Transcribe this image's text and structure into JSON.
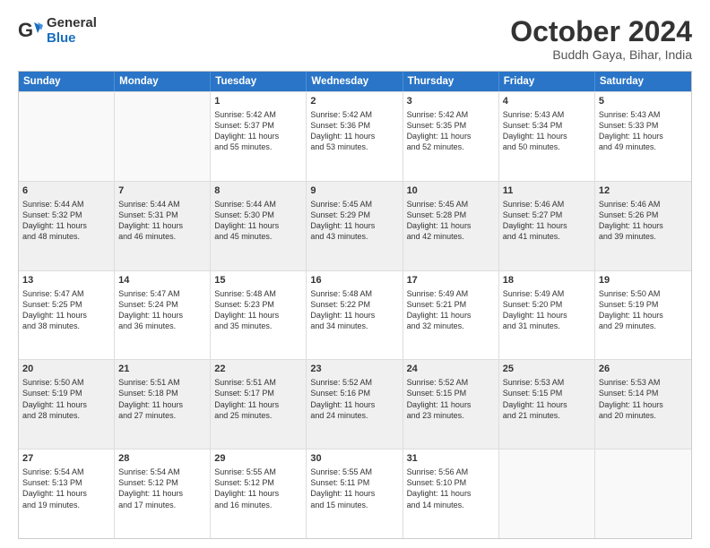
{
  "logo": {
    "general": "General",
    "blue": "Blue"
  },
  "title": {
    "main": "October 2024",
    "sub": "Buddh Gaya, Bihar, India"
  },
  "header_days": [
    "Sunday",
    "Monday",
    "Tuesday",
    "Wednesday",
    "Thursday",
    "Friday",
    "Saturday"
  ],
  "weeks": [
    [
      {
        "day": "",
        "detail": "",
        "empty": true
      },
      {
        "day": "",
        "detail": "",
        "empty": true
      },
      {
        "day": "1",
        "detail": "Sunrise: 5:42 AM\nSunset: 5:37 PM\nDaylight: 11 hours\nand 55 minutes."
      },
      {
        "day": "2",
        "detail": "Sunrise: 5:42 AM\nSunset: 5:36 PM\nDaylight: 11 hours\nand 53 minutes."
      },
      {
        "day": "3",
        "detail": "Sunrise: 5:42 AM\nSunset: 5:35 PM\nDaylight: 11 hours\nand 52 minutes."
      },
      {
        "day": "4",
        "detail": "Sunrise: 5:43 AM\nSunset: 5:34 PM\nDaylight: 11 hours\nand 50 minutes."
      },
      {
        "day": "5",
        "detail": "Sunrise: 5:43 AM\nSunset: 5:33 PM\nDaylight: 11 hours\nand 49 minutes."
      }
    ],
    [
      {
        "day": "6",
        "detail": "Sunrise: 5:44 AM\nSunset: 5:32 PM\nDaylight: 11 hours\nand 48 minutes.",
        "shaded": true
      },
      {
        "day": "7",
        "detail": "Sunrise: 5:44 AM\nSunset: 5:31 PM\nDaylight: 11 hours\nand 46 minutes.",
        "shaded": true
      },
      {
        "day": "8",
        "detail": "Sunrise: 5:44 AM\nSunset: 5:30 PM\nDaylight: 11 hours\nand 45 minutes.",
        "shaded": true
      },
      {
        "day": "9",
        "detail": "Sunrise: 5:45 AM\nSunset: 5:29 PM\nDaylight: 11 hours\nand 43 minutes.",
        "shaded": true
      },
      {
        "day": "10",
        "detail": "Sunrise: 5:45 AM\nSunset: 5:28 PM\nDaylight: 11 hours\nand 42 minutes.",
        "shaded": true
      },
      {
        "day": "11",
        "detail": "Sunrise: 5:46 AM\nSunset: 5:27 PM\nDaylight: 11 hours\nand 41 minutes.",
        "shaded": true
      },
      {
        "day": "12",
        "detail": "Sunrise: 5:46 AM\nSunset: 5:26 PM\nDaylight: 11 hours\nand 39 minutes.",
        "shaded": true
      }
    ],
    [
      {
        "day": "13",
        "detail": "Sunrise: 5:47 AM\nSunset: 5:25 PM\nDaylight: 11 hours\nand 38 minutes."
      },
      {
        "day": "14",
        "detail": "Sunrise: 5:47 AM\nSunset: 5:24 PM\nDaylight: 11 hours\nand 36 minutes."
      },
      {
        "day": "15",
        "detail": "Sunrise: 5:48 AM\nSunset: 5:23 PM\nDaylight: 11 hours\nand 35 minutes."
      },
      {
        "day": "16",
        "detail": "Sunrise: 5:48 AM\nSunset: 5:22 PM\nDaylight: 11 hours\nand 34 minutes."
      },
      {
        "day": "17",
        "detail": "Sunrise: 5:49 AM\nSunset: 5:21 PM\nDaylight: 11 hours\nand 32 minutes."
      },
      {
        "day": "18",
        "detail": "Sunrise: 5:49 AM\nSunset: 5:20 PM\nDaylight: 11 hours\nand 31 minutes."
      },
      {
        "day": "19",
        "detail": "Sunrise: 5:50 AM\nSunset: 5:19 PM\nDaylight: 11 hours\nand 29 minutes."
      }
    ],
    [
      {
        "day": "20",
        "detail": "Sunrise: 5:50 AM\nSunset: 5:19 PM\nDaylight: 11 hours\nand 28 minutes.",
        "shaded": true
      },
      {
        "day": "21",
        "detail": "Sunrise: 5:51 AM\nSunset: 5:18 PM\nDaylight: 11 hours\nand 27 minutes.",
        "shaded": true
      },
      {
        "day": "22",
        "detail": "Sunrise: 5:51 AM\nSunset: 5:17 PM\nDaylight: 11 hours\nand 25 minutes.",
        "shaded": true
      },
      {
        "day": "23",
        "detail": "Sunrise: 5:52 AM\nSunset: 5:16 PM\nDaylight: 11 hours\nand 24 minutes.",
        "shaded": true
      },
      {
        "day": "24",
        "detail": "Sunrise: 5:52 AM\nSunset: 5:15 PM\nDaylight: 11 hours\nand 23 minutes.",
        "shaded": true
      },
      {
        "day": "25",
        "detail": "Sunrise: 5:53 AM\nSunset: 5:15 PM\nDaylight: 11 hours\nand 21 minutes.",
        "shaded": true
      },
      {
        "day": "26",
        "detail": "Sunrise: 5:53 AM\nSunset: 5:14 PM\nDaylight: 11 hours\nand 20 minutes.",
        "shaded": true
      }
    ],
    [
      {
        "day": "27",
        "detail": "Sunrise: 5:54 AM\nSunset: 5:13 PM\nDaylight: 11 hours\nand 19 minutes."
      },
      {
        "day": "28",
        "detail": "Sunrise: 5:54 AM\nSunset: 5:12 PM\nDaylight: 11 hours\nand 17 minutes."
      },
      {
        "day": "29",
        "detail": "Sunrise: 5:55 AM\nSunset: 5:12 PM\nDaylight: 11 hours\nand 16 minutes."
      },
      {
        "day": "30",
        "detail": "Sunrise: 5:55 AM\nSunset: 5:11 PM\nDaylight: 11 hours\nand 15 minutes."
      },
      {
        "day": "31",
        "detail": "Sunrise: 5:56 AM\nSunset: 5:10 PM\nDaylight: 11 hours\nand 14 minutes."
      },
      {
        "day": "",
        "detail": "",
        "empty": true
      },
      {
        "day": "",
        "detail": "",
        "empty": true
      }
    ]
  ]
}
